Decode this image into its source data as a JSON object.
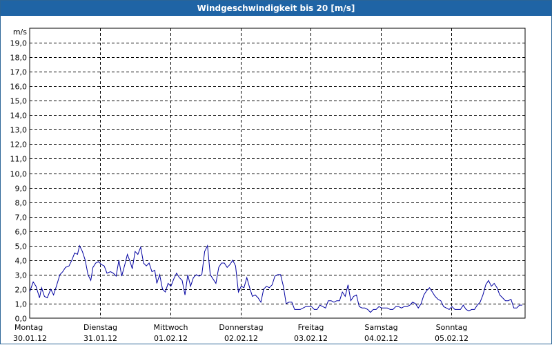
{
  "window": {
    "title": "Windgeschwindigkeit bis 20 [m/s]"
  },
  "chart_data": {
    "type": "line",
    "title": "Windgeschwindigkeit bis 20 [m/s]",
    "ylabel": "m/s",
    "ylim": [
      0,
      20
    ],
    "y_ticks": [
      "0,0",
      "1,0",
      "2,0",
      "3,0",
      "4,0",
      "5,0",
      "6,0",
      "7,0",
      "8,0",
      "9,0",
      "10,0",
      "11,0",
      "12,0",
      "13,0",
      "14,0",
      "15,0",
      "16,0",
      "17,0",
      "18,0",
      "19,0"
    ],
    "x_ticks": [
      {
        "day": "Montag",
        "date": "30.01.12"
      },
      {
        "day": "Dienstag",
        "date": "31.01.12"
      },
      {
        "day": "Mittwoch",
        "date": "01.02.12"
      },
      {
        "day": "Donnerstag",
        "date": "02.02.12"
      },
      {
        "day": "Freitag",
        "date": "03.02.12"
      },
      {
        "day": "Samstag",
        "date": "04.02.12"
      },
      {
        "day": "Sonntag",
        "date": "05.02.12"
      }
    ],
    "x_range_days": [
      0,
      7.05
    ],
    "grid": true,
    "line_color": "#0000a0",
    "series": [
      {
        "x": [
          0.0,
          0.05,
          0.09,
          0.14,
          0.17,
          0.21,
          0.25,
          0.3,
          0.34,
          0.38,
          0.43,
          0.47,
          0.51,
          0.56,
          0.6,
          0.64,
          0.68,
          0.71,
          0.75,
          0.79,
          0.83,
          0.87,
          0.9,
          0.94,
          0.98,
          1.02,
          1.06,
          1.1,
          1.15,
          1.19,
          1.23,
          1.27,
          1.31,
          1.36,
          1.39,
          1.43,
          1.46,
          1.5,
          1.54,
          1.58,
          1.62,
          1.66,
          1.7,
          1.74,
          1.78,
          1.81,
          1.85,
          1.89,
          1.93,
          1.97,
          2.01,
          2.05,
          2.09,
          2.13,
          2.17,
          2.21,
          2.25,
          2.29,
          2.33,
          2.37,
          2.41,
          2.45,
          2.49,
          2.53,
          2.57,
          2.61,
          2.65,
          2.69,
          2.73,
          2.77,
          2.81,
          2.85,
          2.89,
          2.93,
          2.97,
          3.01,
          3.05,
          3.09,
          3.13,
          3.17,
          3.21,
          3.25,
          3.29,
          3.33,
          3.37,
          3.41,
          3.45,
          3.49,
          3.53,
          3.57,
          3.61,
          3.65,
          3.69,
          3.73,
          3.77,
          3.81,
          3.85,
          3.89,
          3.93,
          3.97,
          4.01,
          4.05,
          4.09,
          4.13,
          4.17,
          4.21,
          4.25,
          4.29,
          4.33,
          4.37,
          4.41,
          4.45,
          4.49,
          4.53,
          4.57,
          4.61,
          4.65,
          4.69,
          4.73,
          4.77,
          4.81,
          4.85,
          4.89,
          4.93,
          4.97,
          5.01,
          5.05,
          5.09,
          5.13,
          5.17,
          5.21,
          5.25,
          5.29,
          5.33,
          5.37,
          5.41,
          5.45,
          5.49,
          5.53,
          5.57,
          5.61,
          5.65,
          5.69,
          5.73,
          5.77,
          5.81,
          5.85,
          5.89,
          5.93,
          5.97,
          6.01,
          6.05,
          6.09,
          6.13,
          6.17,
          6.21,
          6.25,
          6.29,
          6.33,
          6.37,
          6.41,
          6.45,
          6.49,
          6.53,
          6.57,
          6.61,
          6.65,
          6.69,
          6.73,
          6.77,
          6.81,
          6.85,
          6.89,
          6.93,
          6.97,
          7.01
        ],
        "y": [
          1.8,
          2.5,
          2.2,
          1.4,
          2.1,
          1.5,
          1.4,
          2.0,
          1.6,
          2.2,
          3.0,
          3.2,
          3.5,
          3.6,
          4.0,
          4.5,
          4.4,
          5.0,
          4.6,
          4.0,
          3.0,
          2.6,
          3.5,
          3.8,
          3.9,
          3.7,
          3.6,
          3.1,
          3.2,
          3.1,
          2.9,
          4.0,
          2.9,
          3.8,
          4.4,
          3.9,
          3.4,
          4.6,
          4.4,
          4.9,
          3.8,
          3.6,
          3.8,
          3.2,
          3.3,
          2.4,
          3.0,
          2.0,
          1.8,
          2.4,
          2.2,
          2.7,
          3.1,
          2.8,
          2.6,
          1.6,
          3.0,
          2.2,
          2.8,
          3.0,
          2.9,
          3.0,
          4.6,
          5.0,
          3.0,
          2.7,
          2.4,
          3.5,
          3.8,
          3.8,
          3.5,
          3.7,
          4.0,
          3.6,
          1.8,
          2.2,
          2.1,
          2.8,
          2.1,
          1.5,
          1.6,
          1.4,
          1.1,
          2.0,
          2.2,
          2.1,
          2.3,
          2.9,
          3.0,
          3.0,
          2.2,
          1.0,
          1.1,
          1.1,
          0.6,
          0.6,
          0.6,
          0.7,
          0.8,
          0.8,
          0.8,
          0.6,
          0.6,
          0.9,
          0.8,
          0.7,
          1.2,
          1.2,
          1.1,
          1.2,
          1.2,
          1.8,
          1.5,
          2.3,
          1.2,
          1.5,
          1.6,
          0.8,
          0.7,
          0.7,
          0.6,
          0.4,
          0.6,
          0.6,
          0.8,
          0.7,
          0.7,
          0.7,
          0.6,
          0.6,
          0.8,
          0.8,
          0.7,
          0.8,
          0.8,
          0.9,
          1.1,
          1.0,
          0.7,
          1.0,
          1.6,
          1.9,
          2.1,
          1.8,
          1.5,
          1.3,
          1.2,
          0.8,
          0.7,
          0.6,
          0.8,
          0.6,
          0.6,
          0.6,
          0.9,
          0.6,
          0.5,
          0.6,
          0.6,
          0.9,
          1.1,
          1.6,
          2.3,
          2.6,
          2.2,
          2.4,
          2.1,
          1.6,
          1.4,
          1.2,
          1.2,
          1.3,
          0.7,
          0.7,
          0.9,
          0.9
        ]
      }
    ]
  }
}
